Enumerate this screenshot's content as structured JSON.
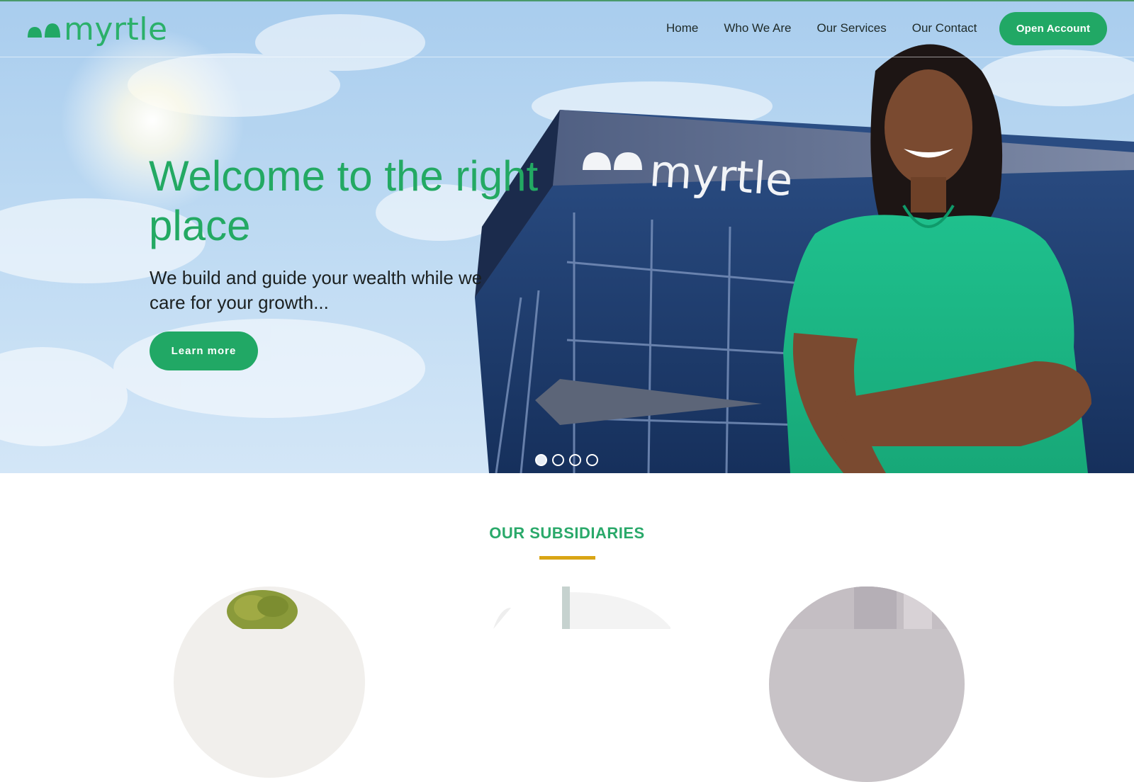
{
  "brand": {
    "name": "myrtle",
    "accent_color": "#21a865",
    "gold_color": "#d9a514"
  },
  "nav": {
    "items": [
      {
        "label": "Home"
      },
      {
        "label": "Who We Are"
      },
      {
        "label": "Our Services"
      },
      {
        "label": "Our Contact"
      }
    ],
    "cta_label": "Open Account"
  },
  "hero": {
    "title": "Welcome to the right place",
    "subtitle": "We build and guide your wealth while we care for your growth...",
    "button_label": "Learn more",
    "building_sign": "myrtle",
    "slides": {
      "count": 4,
      "active_index": 0
    }
  },
  "subsidiaries": {
    "heading": "OUR SUBSIDIARIES"
  },
  "icons": {
    "logo_mark": "two-mound-logo-icon"
  }
}
